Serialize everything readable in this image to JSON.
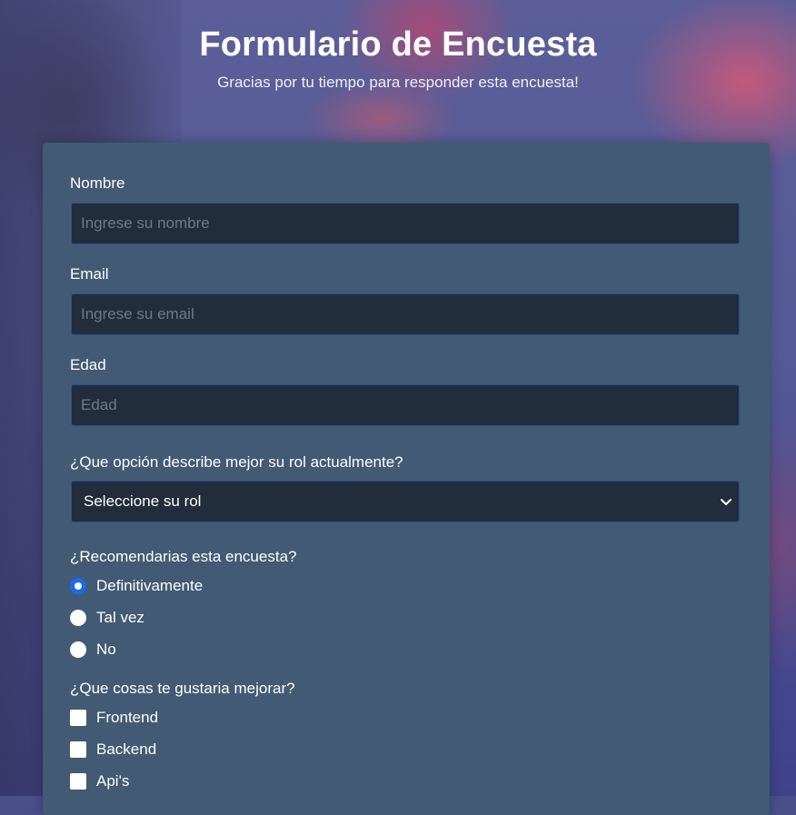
{
  "header": {
    "title": "Formulario de Encuesta",
    "subtitle": "Gracias por tu tiempo para responder esta encuesta!"
  },
  "form": {
    "name": {
      "label": "Nombre",
      "placeholder": "Ingrese su nombre"
    },
    "email": {
      "label": "Email",
      "placeholder": "Ingrese su email"
    },
    "age": {
      "label": "Edad",
      "placeholder": "Edad"
    },
    "role": {
      "label": "¿Que opción describe mejor su rol actualmente?",
      "selected": "Seleccione su rol"
    },
    "recommend": {
      "label": "¿Recomendarias esta encuesta?",
      "options": [
        {
          "label": "Definitivamente",
          "checked": true
        },
        {
          "label": "Tal vez",
          "checked": false
        },
        {
          "label": "No",
          "checked": false
        }
      ]
    },
    "improve": {
      "label": "¿Que cosas te gustaria mejorar?",
      "options": [
        {
          "label": "Frontend",
          "checked": false
        },
        {
          "label": "Backend",
          "checked": false
        },
        {
          "label": "Api's",
          "checked": false
        }
      ]
    }
  },
  "colors": {
    "card": "#425a73",
    "input_bg": "#212d3a",
    "input_border": "#2c4e9a",
    "radio_checked": "#1a6bf0"
  }
}
